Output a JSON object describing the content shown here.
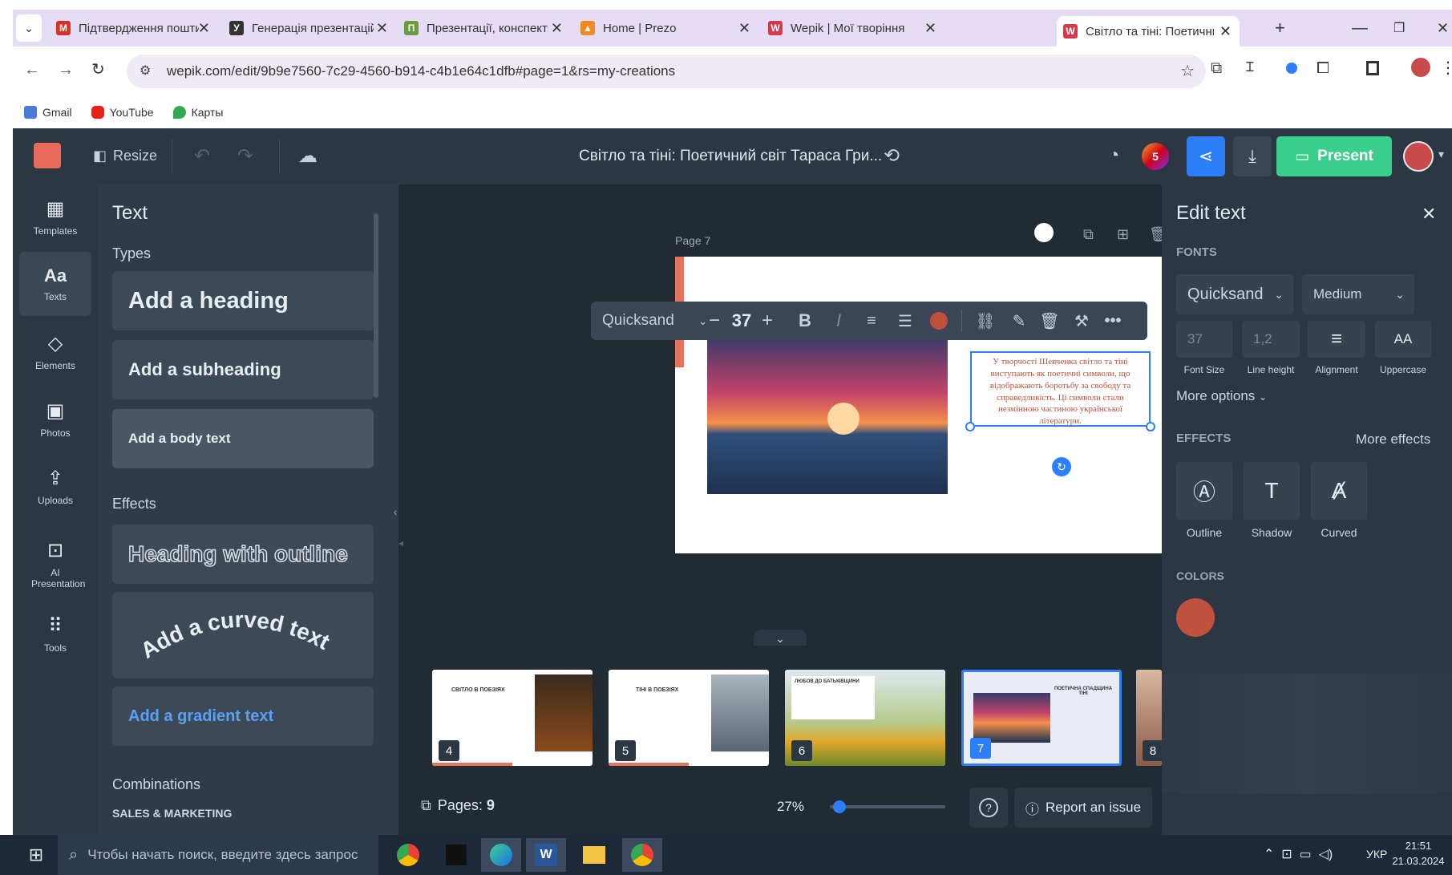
{
  "browser": {
    "tabs": [
      {
        "title": "Підтвердження пошти - с",
        "icon": "gmail-icon",
        "color": "#d93025"
      },
      {
        "title": "Генерація презентацій за",
        "icon": "yandex-icon",
        "color": "#333333"
      },
      {
        "title": "Презентації, конспекти до",
        "icon": "site-icon",
        "color": "#6a9b3c"
      },
      {
        "title": "Home | Prezo",
        "icon": "prezo-icon",
        "color": "#f08a24"
      },
      {
        "title": "Wepik | Мої творіння",
        "icon": "wepik-icon",
        "color": "#d33a4a"
      },
      {
        "title": "Світло та тіні: Поетичний",
        "icon": "wepik-icon",
        "color": "#d33a4a"
      }
    ],
    "url": "wepik.com/edit/9b9e7560-7c29-4560-b914-c4b1e64c1dfb#page=1&rs=my-creations",
    "bookmarks": [
      {
        "label": "Gmail",
        "color": "#4a7bd8"
      },
      {
        "label": "YouTube",
        "color": "#e62117"
      },
      {
        "label": "Карты",
        "color": "#34a853"
      }
    ]
  },
  "topbar": {
    "resize": "Resize",
    "doc_title": "Світло та тіні: Поетичний світ Тараса Гри...",
    "badge": "5",
    "present": "Present"
  },
  "rail": [
    {
      "label": "Templates",
      "icon": "▦"
    },
    {
      "label": "Texts",
      "icon": "Aa"
    },
    {
      "label": "Elements",
      "icon": "◇"
    },
    {
      "label": "Photos",
      "icon": "▣"
    },
    {
      "label": "Uploads",
      "icon": "⇪"
    },
    {
      "label": "AI Presentation",
      "icon": "⊡"
    },
    {
      "label": "Tools",
      "icon": "⠿"
    }
  ],
  "text_panel": {
    "title": "Text",
    "types": "Types",
    "heading": "Add a heading",
    "subheading": "Add a subheading",
    "body": "Add a body text",
    "effects": "Effects",
    "outline": "Heading with outline",
    "curved": "Add a curved text",
    "gradient": "Add a gradient text",
    "combinations": "Combinations",
    "sales": "SALES & MARKETING"
  },
  "canvas": {
    "page_label": "Page 7",
    "font": "Quicksand",
    "size": "37",
    "body": "У творчості Шевченка світло та тіні виступають як поетичні символи, що відображають боротьбу за свободу та справедливість. Ці символи стали незмінною частиною української літератури.",
    "text_color": "#c0513c"
  },
  "thumbnails": [
    {
      "num": "4",
      "title": "СВІТЛО В ПОЕЗІЯХ"
    },
    {
      "num": "5",
      "title": "ТІНІ В ПОЕЗІЯХ"
    },
    {
      "num": "6",
      "title": "ЛЮБОВ ДО БАТЬКІВЩИНИ"
    },
    {
      "num": "7",
      "title": "ПОЕТИЧНА СПАДЩИНА ТІНІ"
    },
    {
      "num": "8",
      "title": ""
    }
  ],
  "bottom": {
    "pages": "Pages:",
    "pages_count": "9",
    "zoom": "27%",
    "zoom_level": 0.03,
    "help": "?",
    "report": "Report an issue"
  },
  "edit_panel": {
    "title": "Edit text",
    "fonts": "FONTS",
    "font": "Quicksand",
    "weight": "Medium",
    "font_size": "37",
    "line_height": "1,2",
    "font_size_label": "Font Size",
    "line_height_label": "Line height",
    "alignment_label": "Alignment",
    "uppercase_label": "Uppercase",
    "uppercase_glyph": "AA",
    "more_options": "More options",
    "effects": "EFFECTS",
    "more_effects": "More effects",
    "outline": "Outline",
    "shadow": "Shadow",
    "curved": "Curved",
    "colors": "COLORS",
    "color": "#c0513c"
  },
  "taskbar": {
    "search": "Чтобы начать поиск, введите здесь запрос",
    "lang": "УКР",
    "time": "21:51",
    "date": "21.03.2024"
  },
  "colors": {
    "accent_blue": "#2d7ff9",
    "present_green": "#3bcf8e"
  }
}
